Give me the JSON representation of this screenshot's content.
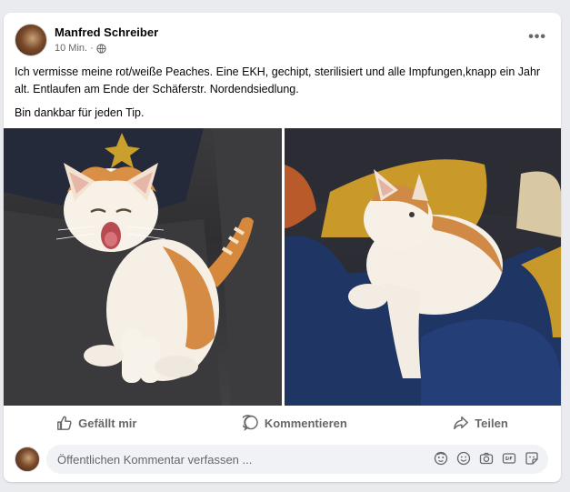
{
  "post": {
    "author": "Manfred Schreiber",
    "time": "10 Min.",
    "separator": "·",
    "more_label": "•••",
    "text_paragraphs": [
      "Ich vermisse meine rot/weiße Peaches. Eine EKH, gechipt, sterilisiert und alle Impfungen,knapp ein Jahr alt. Entlaufen am Ende der Schäferstr. Nordendsiedlung.",
      "Bin dankbar für jeden Tip."
    ]
  },
  "actions": {
    "like": "Gefällt mir",
    "comment": "Kommentieren",
    "share": "Teilen"
  },
  "comment_box": {
    "placeholder": "Öffentlichen Kommentar verfassen ..."
  },
  "icons": {
    "privacy": "globe-icon",
    "like": "thumbs-up-icon",
    "comment": "speech-bubble-icon",
    "share": "share-arrow-icon",
    "avatar_frame": "avatar-frame-icon",
    "emoji": "smiley-icon",
    "camera": "camera-icon",
    "gif": "gif-icon",
    "sticker": "sticker-icon"
  },
  "colors": {
    "text_primary": "#050505",
    "text_secondary": "#65676b",
    "card_bg": "#ffffff",
    "page_bg": "#e9ebee",
    "comment_bg": "#f0f2f5"
  }
}
